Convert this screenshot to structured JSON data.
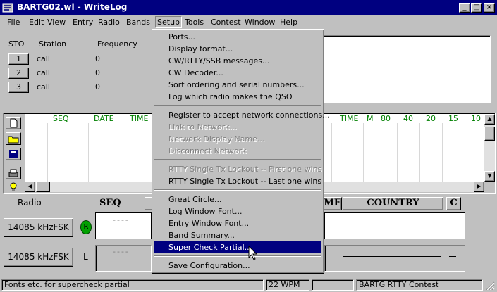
{
  "title": "BARTG02.wl - WriteLog",
  "menubar": [
    "File",
    "Edit",
    "View",
    "Entry",
    "Radio",
    "Bands",
    "Setup",
    "Tools",
    "Contest",
    "Window",
    "Help"
  ],
  "sto": {
    "headers": [
      "STO",
      "Station",
      "Frequency"
    ],
    "rows": [
      {
        "btn": "1",
        "station": "call",
        "freq": "0"
      },
      {
        "btn": "2",
        "station": "call",
        "freq": "0"
      },
      {
        "btn": "3",
        "station": "call",
        "freq": "0"
      }
    ]
  },
  "log_columns_left": [
    "SEQ",
    "DATE",
    "TIME"
  ],
  "log_columns_right": [
    "TIME",
    "M",
    "80",
    "40",
    "20",
    "15",
    "10"
  ],
  "radio": {
    "label": "Radio",
    "freq1": "14085 kHzFSK",
    "freq2": "14085 kHzFSK",
    "led_r": "R",
    "led_l": "L",
    "dashes": "----"
  },
  "entry_headers": {
    "seq": "SEQ",
    "time": "ME",
    "country": "COUNTRY",
    "c": "C"
  },
  "setup_menu": [
    {
      "label": "Ports...",
      "disabled": false
    },
    {
      "label": "Display format...",
      "disabled": false
    },
    {
      "label": "CW/RTTY/SSB messages...",
      "disabled": false
    },
    {
      "label": "CW Decoder...",
      "disabled": false
    },
    {
      "label": "Sort ordering and serial numbers...",
      "disabled": false
    },
    {
      "label": "Log which radio makes the QSO",
      "disabled": false
    },
    {
      "label": "Register to accept network connections...",
      "disabled": false
    },
    {
      "label": "Link to Network...",
      "disabled": true
    },
    {
      "label": "Network Display Name...",
      "disabled": true
    },
    {
      "label": "Disconnect Network",
      "disabled": true
    },
    {
      "label": "RTTY Single Tx Lockout -- First one wins",
      "disabled": true
    },
    {
      "label": "RTTY Single Tx Lockout -- Last one wins",
      "disabled": false
    },
    {
      "label": "Great Circle...",
      "disabled": false
    },
    {
      "label": "Log Window Font...",
      "disabled": false
    },
    {
      "label": "Entry Window Font...",
      "disabled": false
    },
    {
      "label": "Band Summary...",
      "disabled": false
    },
    {
      "label": "Super Check Partial...",
      "disabled": false,
      "selected": true
    },
    {
      "label": "Save Configuration...",
      "disabled": false
    }
  ],
  "status": {
    "hint": "Fonts etc. for supercheck partial",
    "wpm": "22 WPM",
    "contest": "BARTG RTTY Contest"
  },
  "colors": {
    "titlebar": "#000080",
    "face": "#c0c0c0",
    "column_header": "#008000",
    "led": "#00a000"
  }
}
